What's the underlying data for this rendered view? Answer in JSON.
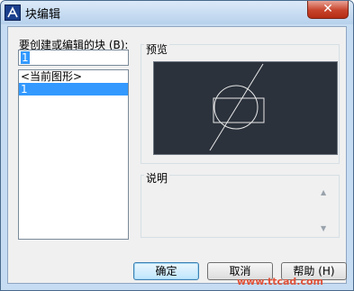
{
  "window": {
    "title": "块编辑",
    "app_icon": "autocad-logo-icon",
    "close_icon": "close-icon"
  },
  "block_name": {
    "label": "要创建或编辑的块 (B):",
    "input_value": "1"
  },
  "block_list": {
    "items": [
      {
        "label": "<当前图形>",
        "selected": false
      },
      {
        "label": "1",
        "selected": true
      }
    ]
  },
  "preview": {
    "label": "预览"
  },
  "description": {
    "label": "说明",
    "text": ""
  },
  "buttons": {
    "ok": "确定",
    "cancel": "取消",
    "help": "帮助 (H)"
  },
  "watermark": "www.ttcad.com",
  "colors": {
    "title_bar": "#c6dcf2",
    "close_button": "#c7432b",
    "preview_background": "#2b323c",
    "preview_lines": "#e8e8e8",
    "selection": "#3399ff"
  }
}
